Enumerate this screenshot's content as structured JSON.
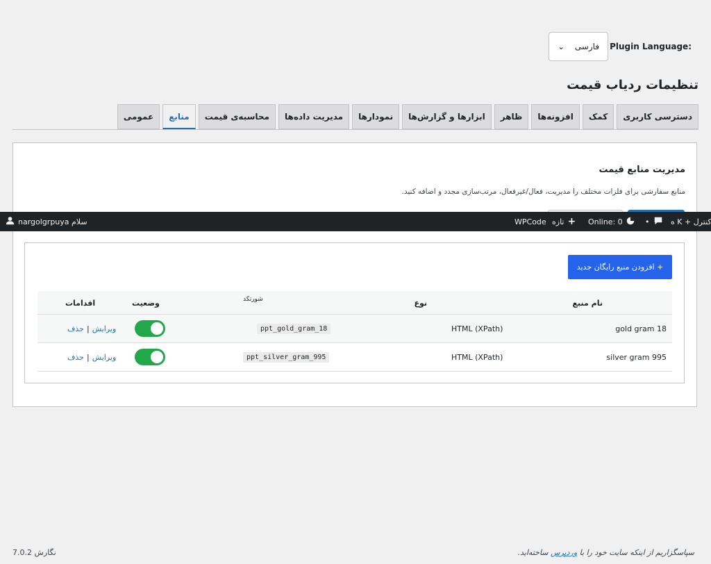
{
  "plugin_language": {
    "label": "Plugin Language:",
    "selected": "فارسی"
  },
  "page_title": "تنظیمات ردیاب قیمت",
  "tabs": [
    {
      "label": "عمومی"
    },
    {
      "label": "منابع"
    },
    {
      "label": "محاسبه‌ی قیمت"
    },
    {
      "label": "مدیریت داده‌ها"
    },
    {
      "label": "نمودارها"
    },
    {
      "label": "ابزارها و گزارش‌ها"
    },
    {
      "label": "ظاهر"
    },
    {
      "label": "افزونه‌ها"
    },
    {
      "label": "کمک"
    },
    {
      "label": "دسترسی کاربری"
    }
  ],
  "active_tab": "منابع",
  "section": {
    "title": "مدیریت منابع قیمت",
    "description": "منابع سفارشی برای فلزات مختلف را مدیریت، فعال/غیرفعال، مرتب‌سازی مجدد و اضافه کنید."
  },
  "admin_bar": {
    "greeting": "سلام nargolgrpuya",
    "dashboard": "کنترل + K ه",
    "dot": "•",
    "online": "Online: 0",
    "new": "تازه",
    "wpcode": "WPCode"
  },
  "add_button": "+ افزودن منبع رایگان جدید",
  "table": {
    "headers": {
      "name": "نام منبع",
      "type": "نوع",
      "shortcode": "شورتکد",
      "status": "وضعیت",
      "actions": "اقدامات"
    },
    "rows": [
      {
        "name": "gold gram 18",
        "type": "HTML (XPath)",
        "shortcode": "ppt_gold_gram_18",
        "enabled": true,
        "edit": "ویرایش",
        "sep": "|",
        "delete": "حذف"
      },
      {
        "name": "silver gram 995",
        "type": "HTML (XPath)",
        "shortcode": "ppt_silver_gram_995",
        "enabled": true,
        "edit": "ویرایش",
        "sep": "|",
        "delete": "حذف"
      }
    ]
  },
  "footer": {
    "thanks_before": "سپاسگزاریم از اینکه سایت خود را با",
    "wordpress_link": "وردپرس",
    "thanks_after": "ساخته‌اید.",
    "version": "نگارش 7.0.2"
  },
  "colors": {
    "primary": "#2271b1",
    "button_blue": "#2563eb",
    "toggle_on": "#22a74a",
    "admin_bar": "#1d2327"
  }
}
